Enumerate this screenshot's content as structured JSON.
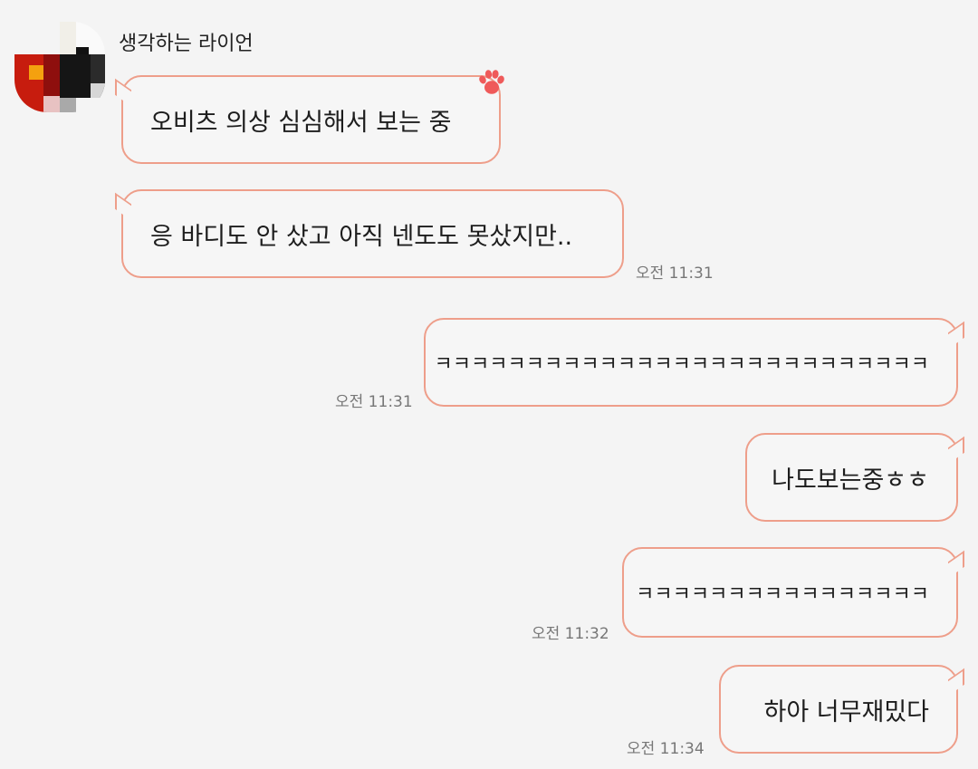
{
  "sender": {
    "name": "생각하는 라이언"
  },
  "colors": {
    "background": "#f4f4f4",
    "bubble_border": "#ee9e8a",
    "paw": "#ef5a5a",
    "timestamp": "#777777"
  },
  "messages": [
    {
      "direction": "incoming",
      "text": "오비츠 의상 심심해서 보는 중",
      "time": ""
    },
    {
      "direction": "incoming",
      "text": "응 바디도 안 샀고 아직 넨도도 못샀지만..",
      "time": "오전 11:31"
    },
    {
      "direction": "outgoing",
      "text": "ㅋㅋㅋㅋㅋㅋㅋㅋㅋㅋㅋㅋㅋㅋㅋㅋㅋㅋㅋㅋㅋㅋㅋㅋㅋㅋㅋ",
      "time": "오전 11:31"
    },
    {
      "direction": "outgoing",
      "text": "나도보는중ㅎㅎ",
      "time": ""
    },
    {
      "direction": "outgoing",
      "text": "ㅋㅋㅋㅋㅋㅋㅋㅋㅋㅋㅋㅋㅋㅋㅋㅋ",
      "time": "오전 11:32"
    },
    {
      "direction": "outgoing",
      "text": "하아 너무재밌다",
      "time": "오전 11:34"
    }
  ]
}
